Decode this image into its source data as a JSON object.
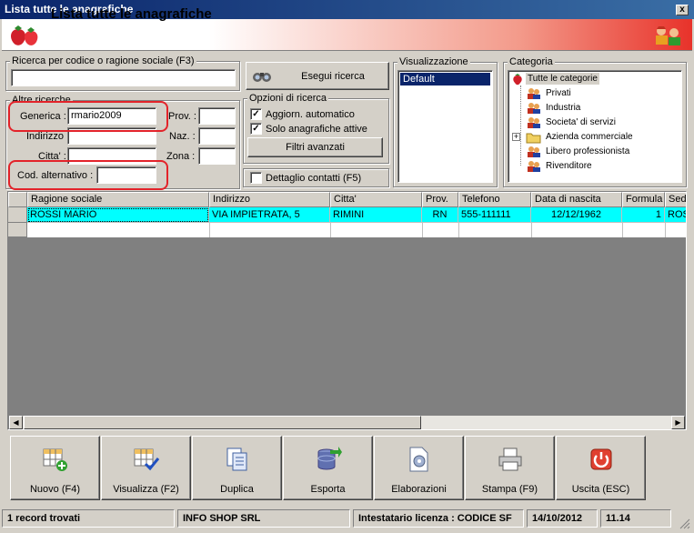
{
  "window": {
    "title": "Lista tutte le anagrafiche",
    "close_glyph": "x"
  },
  "header": {
    "title": "Lista tutte le anagrafiche"
  },
  "search": {
    "group_label": "Ricerca per codice o ragione sociale (F3)",
    "value": "",
    "execute_label": "Esegui ricerca"
  },
  "other": {
    "group_label": "Altre ricerche",
    "generica_label": "Generica :",
    "generica_value": "rmario2009",
    "indirizzo_label": "Indirizzo :",
    "indirizzo_value": "",
    "citta_label": "Citta' :",
    "citta_value": "",
    "cod_alt_label": "Cod. alternativo :",
    "cod_alt_value": "",
    "prov_label": "Prov. :",
    "prov_value": "",
    "naz_label": "Naz. :",
    "naz_value": "",
    "zona_label": "Zona :",
    "zona_value": ""
  },
  "options": {
    "group_label": "Opzioni di ricerca",
    "auto_update_label": "Aggiorn. automatico",
    "auto_update_checked": "✓",
    "active_only_label": "Solo anagrafiche attive",
    "active_only_checked": "✓",
    "advanced_filters_label": "Filtri avanzati",
    "contact_detail_label": "Dettaglio contatti (F5)",
    "contact_detail_checked": ""
  },
  "view": {
    "group_label": "Visualizzazione",
    "items": [
      "Default"
    ],
    "selected": "Default"
  },
  "category": {
    "group_label": "Categoria",
    "root": "Tutte le categorie",
    "items": [
      "Privati",
      "Industria",
      "Societa' di servizi",
      "Azienda commerciale",
      "Libero professionista",
      "Rivenditore"
    ],
    "expand_glyph": "+"
  },
  "grid": {
    "columns": [
      "Ragione sociale",
      "Indirizzo",
      "Citta'",
      "Prov.",
      "Telefono",
      "Data di nascita",
      "Formula",
      "Sede"
    ],
    "rows": [
      {
        "ragione_sociale": "ROSSI MARIO",
        "indirizzo": "VIA IMPIETRATA, 5",
        "citta": "RIMINI",
        "prov": "RN",
        "telefono": "555-111111",
        "data_nascita": "12/12/1962",
        "formula": "1",
        "sede": "ROS"
      }
    ],
    "scroll_left": "◀",
    "scroll_right": "▶"
  },
  "toolbar": {
    "buttons": [
      "Nuovo (F4)",
      "Visualizza (F2)",
      "Duplica",
      "Esporta",
      "Elaborazioni",
      "Stampa (F9)",
      "Uscita (ESC)"
    ]
  },
  "status": {
    "records": "1 record trovati",
    "company": "INFO SHOP SRL",
    "license": "Intestatario licenza : CODICE SF",
    "date": "14/10/2012",
    "time": "11.14"
  },
  "colors": {
    "accent_red": "#e3232a",
    "row_highlight": "#00ffff",
    "selection": "#0a246a"
  }
}
